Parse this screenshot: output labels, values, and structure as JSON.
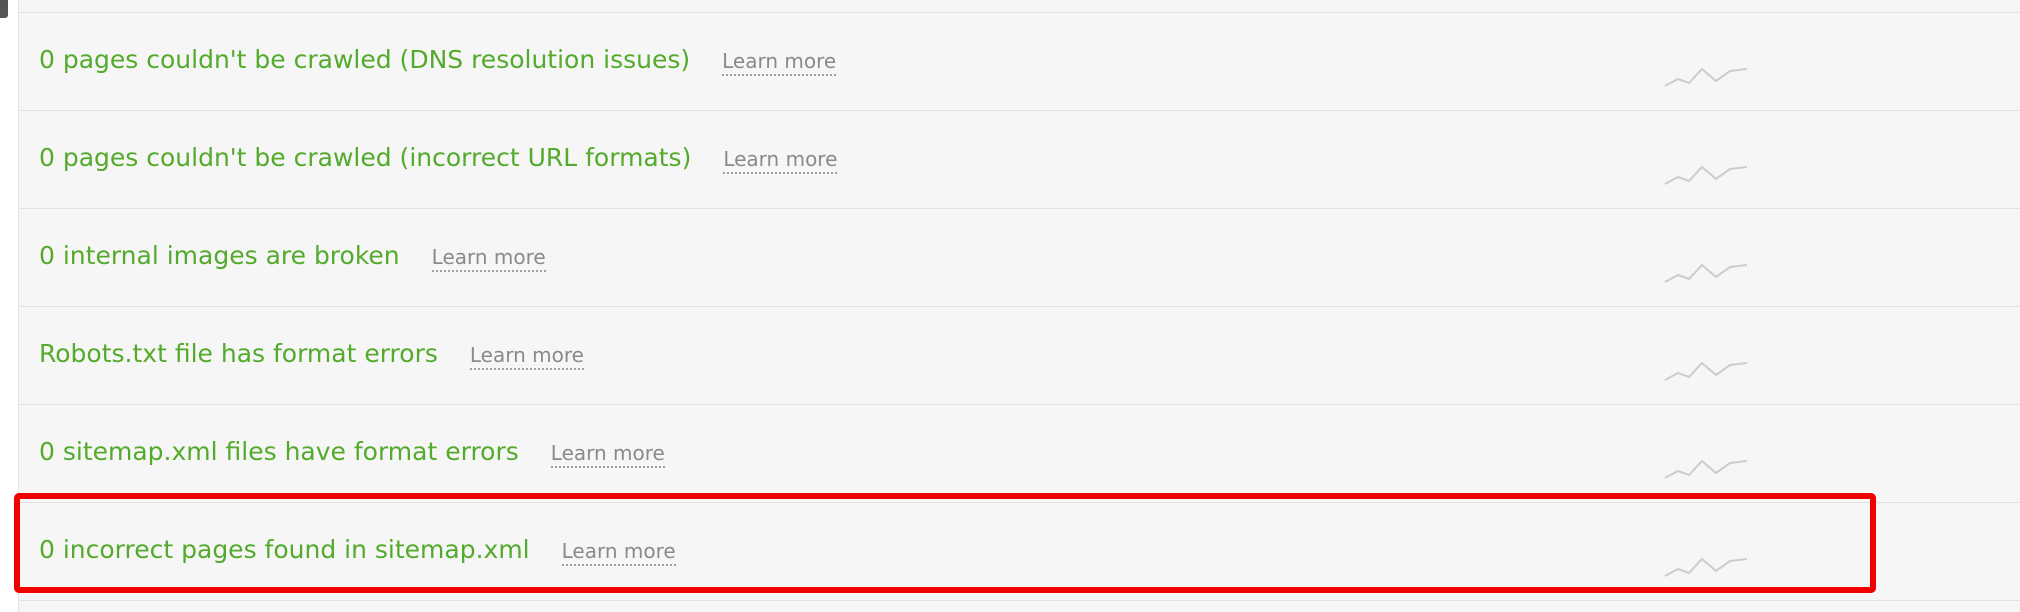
{
  "rows": [
    {
      "issue": "0 pages couldn't be crawled (DNS resolution issues)",
      "link": "Learn more"
    },
    {
      "issue": "0 pages couldn't be crawled (incorrect URL formats)",
      "link": "Learn more"
    },
    {
      "issue": "0 internal images are broken",
      "link": "Learn more"
    },
    {
      "issue": "Robots.txt file has format errors",
      "link": "Learn more"
    },
    {
      "issue": "0 sitemap.xml files have format errors",
      "link": "Learn more"
    },
    {
      "issue": "0 incorrect pages found in sitemap.xml",
      "link": "Learn more"
    }
  ],
  "highlighted_row_index": 5,
  "colors": {
    "issue_text": "#53aa2b",
    "link_text": "#8a8a8a",
    "panel_bg": "#f6f6f6",
    "sparkline": "#cccccc",
    "highlight": "#f00000"
  },
  "icons": {
    "trend": "sparkline-icon"
  }
}
